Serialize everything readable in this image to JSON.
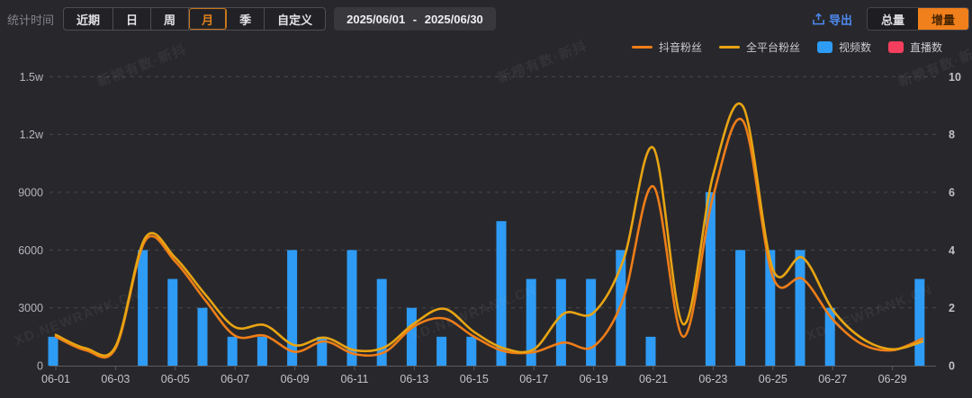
{
  "toolbar": {
    "label": "统计时间",
    "periods": [
      "近期",
      "日",
      "周",
      "月",
      "季",
      "自定义"
    ],
    "active_period": "月",
    "date_range": "2025/06/01 - 2025/06/30",
    "export_label": "导出",
    "toggle_options": [
      "总量",
      "增量"
    ],
    "active_toggle": "增量"
  },
  "colors": {
    "accent_orange": "#f0801b",
    "export_blue": "#4e8af2",
    "douyin_line": "#ee7d18",
    "allplatform_line": "#e8a412",
    "video_bar": "#2e9bf5",
    "live_bar": "#f43e5d",
    "background": "#28282c"
  },
  "watermarks": {
    "texts": [
      "新榜有数·新抖",
      "XD.NEWRANK.CN"
    ]
  },
  "chart_data": {
    "type": "combo",
    "x": [
      "06-01",
      "06-02",
      "06-03",
      "06-04",
      "06-05",
      "06-06",
      "06-07",
      "06-08",
      "06-09",
      "06-10",
      "06-11",
      "06-12",
      "06-13",
      "06-14",
      "06-15",
      "06-16",
      "06-17",
      "06-18",
      "06-19",
      "06-20",
      "06-21",
      "06-22",
      "06-23",
      "06-24",
      "06-25",
      "06-26",
      "06-27",
      "06-28",
      "06-29",
      "06-30"
    ],
    "x_labeled_ticks": [
      "06-01",
      "06-03",
      "06-05",
      "06-07",
      "06-09",
      "06-11",
      "06-13",
      "06-15",
      "06-17",
      "06-19",
      "06-21",
      "06-23",
      "06-25",
      "06-27",
      "06-29"
    ],
    "series": [
      {
        "name": "抖音粉丝",
        "type": "line",
        "axis": "left",
        "color": "#ee7d18",
        "values": [
          1500,
          800,
          900,
          6500,
          5400,
          3400,
          1550,
          1550,
          720,
          1260,
          600,
          700,
          2050,
          2450,
          1500,
          750,
          700,
          1200,
          1000,
          3500,
          9300,
          1500,
          8800,
          12700,
          4600,
          4500,
          2400,
          1100,
          800,
          1400
        ]
      },
      {
        "name": "全平台粉丝",
        "type": "line",
        "axis": "left",
        "color": "#e8a412",
        "values": [
          1600,
          900,
          1000,
          6650,
          5600,
          3700,
          2000,
          2100,
          1060,
          1450,
          800,
          950,
          2200,
          2950,
          1750,
          900,
          850,
          2700,
          2750,
          5500,
          11300,
          2150,
          9900,
          13450,
          5000,
          5600,
          2900,
          1400,
          850,
          1250
        ]
      },
      {
        "name": "视频数",
        "type": "bar",
        "axis": "right",
        "color": "#2e9bf5",
        "values": [
          1,
          0,
          0,
          4,
          3,
          2,
          1,
          1,
          4,
          1,
          4,
          3,
          2,
          1,
          1,
          5,
          3,
          3,
          3,
          4,
          1,
          0,
          6,
          4,
          4,
          4,
          2,
          0,
          0,
          3
        ]
      },
      {
        "name": "直播数",
        "type": "bar",
        "axis": "right",
        "color": "#f43e5d",
        "values": [
          0,
          0,
          0,
          0,
          0,
          0,
          0,
          0,
          0,
          0,
          0,
          0,
          0,
          0,
          0,
          0,
          0,
          0,
          0,
          0,
          0,
          0,
          0,
          0,
          0,
          0,
          0,
          0,
          0,
          0
        ]
      }
    ],
    "left_axis": {
      "ticks": [
        "0",
        "3000",
        "6000",
        "9000",
        "1.2w",
        "1.5w"
      ],
      "min": 0,
      "max": 15000
    },
    "right_axis": {
      "ticks": [
        "0",
        "2",
        "4",
        "6",
        "8",
        "10"
      ],
      "min": 0,
      "max": 10
    },
    "grid": "horizontal dashed",
    "legend_position": "top-right"
  }
}
